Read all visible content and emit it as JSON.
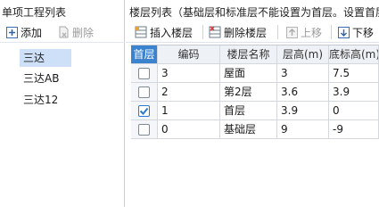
{
  "left_panel": {
    "title": "单项工程列表",
    "toolbar": {
      "add_label": "添加",
      "delete_label": "删除"
    },
    "projects": [
      "三达",
      "三达AB",
      "三达12"
    ],
    "selected_project": "三达"
  },
  "right_panel": {
    "title": "楼层列表（基础层和标准层不能设置为首层。设置首层后",
    "toolbar": {
      "insert_label": "插入楼层",
      "delete_label": "删除楼层",
      "up_label": "上移",
      "down_label": "下移"
    },
    "table": {
      "headers": [
        "首层",
        "编码",
        "楼层名称",
        "层高(m)",
        "底标高(m)"
      ],
      "rows": [
        {
          "first": false,
          "code": "3",
          "name": "屋面",
          "height": "3",
          "bottom": "7.5"
        },
        {
          "first": false,
          "code": "2",
          "name": "第2层",
          "height": "3.6",
          "bottom": "3.9"
        },
        {
          "first": true,
          "code": "1",
          "name": "首层",
          "height": "3.9",
          "bottom": "0"
        },
        {
          "first": false,
          "code": "0",
          "name": "基础层",
          "height": "9",
          "bottom": "-9"
        }
      ]
    }
  },
  "colors": {
    "accent": "#3b82cf",
    "selection": "#cde0f7",
    "check": "#2b79d0"
  }
}
